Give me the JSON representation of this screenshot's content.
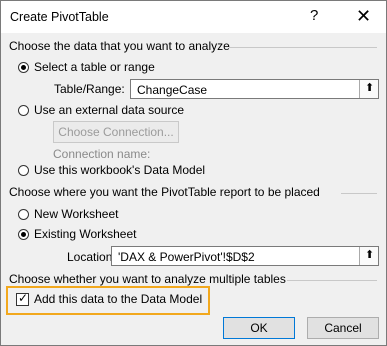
{
  "dialog": {
    "title": "Create PivotTable",
    "help_glyph": "?",
    "close_glyph": "✕"
  },
  "section1": {
    "heading": "Choose the data that you want to analyze",
    "select_table": "Select a table or range",
    "table_range_label": "Table/Range:",
    "table_range_value": "ChangeCase",
    "external_source": "Use an external data source",
    "choose_connection": "Choose Connection...",
    "connection_name": "Connection name:",
    "data_model": "Use this workbook's Data Model"
  },
  "section2": {
    "heading": "Choose where you want the PivotTable report to be placed",
    "new_worksheet": "New Worksheet",
    "existing_worksheet": "Existing Worksheet",
    "location_label": "Location:",
    "location_value": "'DAX & PowerPivot'!$D$2"
  },
  "section3": {
    "heading": "Choose whether you want to analyze multiple tables",
    "add_to_model": "Add this data to the Data Model"
  },
  "buttons": {
    "ok": "OK",
    "cancel": "Cancel"
  },
  "icons": {
    "range_picker": "range-picker-icon",
    "accent": "#f2a81d"
  }
}
